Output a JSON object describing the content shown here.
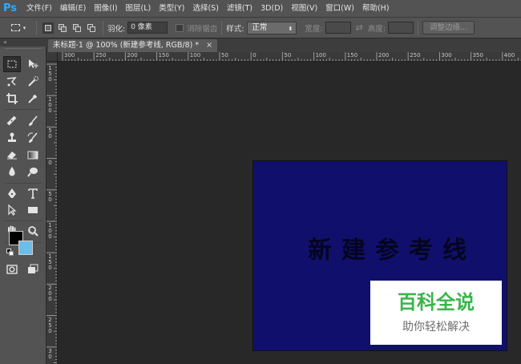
{
  "app_logo": "Ps",
  "menu": [
    "文件(F)",
    "编辑(E)",
    "图像(I)",
    "图层(L)",
    "类型(Y)",
    "选择(S)",
    "滤镜(T)",
    "3D(D)",
    "视图(V)",
    "窗口(W)",
    "帮助(H)"
  ],
  "options": {
    "feather_label": "羽化:",
    "feather_value": "0 像素",
    "antialias_label": "消除锯齿",
    "style_label": "样式:",
    "style_value": "正常",
    "width_label": "宽度:",
    "height_label": "高度:",
    "refine_edge_label": "调整边缘..."
  },
  "toolbar_collapse": "«",
  "document": {
    "tab_title": "未标题-1 @ 100% (新建参考线, RGB/8) *",
    "close_glyph": "×"
  },
  "ruler_top_labels": [
    "300",
    "250",
    "200",
    "150",
    "100",
    "50",
    "0",
    "50",
    "100",
    "150",
    "200",
    "250",
    "300",
    "350",
    "400"
  ],
  "ruler_left_labels": [
    "1\n5\n0",
    "1\n0\n0",
    "5\n0",
    "0",
    "5\n0",
    "1\n0\n0",
    "1\n5\n0",
    "2\n0\n0",
    "2\n5\n0",
    "3\n0"
  ],
  "canvas": {
    "text": "新建参考线",
    "background_color": "#10106c"
  },
  "colors": {
    "foreground": "#000000",
    "background": "#6cbde8"
  },
  "watermark": {
    "title": "百科全说",
    "subtitle": "助你轻松解决"
  }
}
